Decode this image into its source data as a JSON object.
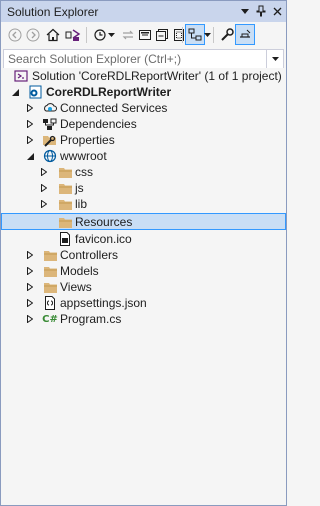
{
  "window": {
    "title": "Solution Explorer"
  },
  "search": {
    "placeholder": "Search Solution Explorer (Ctrl+;)"
  },
  "tree": {
    "solution": "Solution 'CoreRDLReportWriter' (1 of 1 project)",
    "project": "CoreRDLReportWriter",
    "connected_services": "Connected Services",
    "dependencies": "Dependencies",
    "properties": "Properties",
    "wwwroot": "wwwroot",
    "css": "css",
    "js": "js",
    "lib": "lib",
    "resources": "Resources",
    "favicon": "favicon.ico",
    "controllers": "Controllers",
    "models": "Models",
    "views": "Views",
    "appsettings": "appsettings.json",
    "program": "Program.cs"
  },
  "colors": {
    "titlebar": "#C9D5EC",
    "selection": "#C9DEF5",
    "selection_border": "#3399FF",
    "folder": "#DCB67A",
    "accent": "#005A9E"
  }
}
